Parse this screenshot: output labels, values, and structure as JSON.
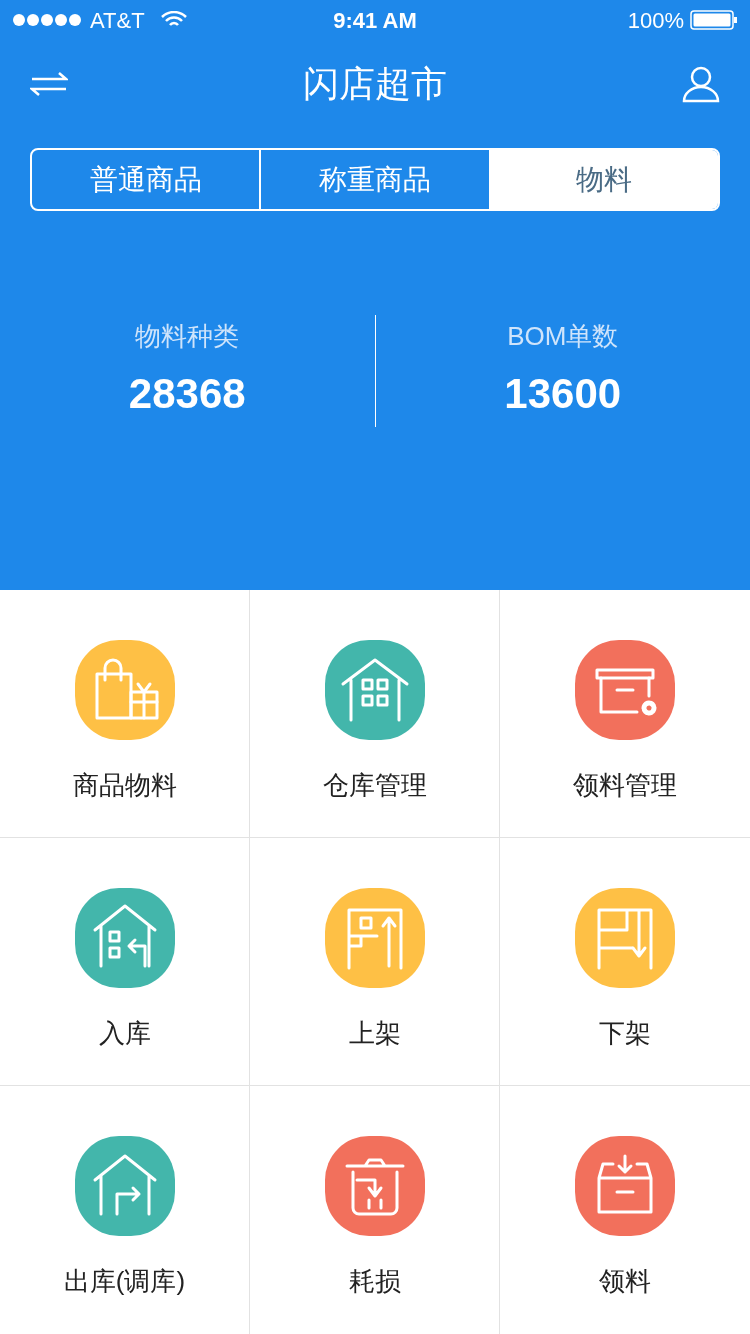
{
  "status_bar": {
    "carrier": "AT&T",
    "time": "9:41 AM",
    "battery": "100%"
  },
  "header": {
    "title": "闪店超市"
  },
  "tabs": [
    {
      "label": "普通商品",
      "selected": false
    },
    {
      "label": "称重商品",
      "selected": false
    },
    {
      "label": "物料",
      "selected": true
    }
  ],
  "stats": [
    {
      "label": "物料种类",
      "value": "28368"
    },
    {
      "label": "BOM单数",
      "value": "13600"
    }
  ],
  "menu": [
    {
      "label": "商品物料",
      "color": "#fec045"
    },
    {
      "label": "仓库管理",
      "color": "#43b6ab"
    },
    {
      "label": "领料管理",
      "color": "#f2705c"
    },
    {
      "label": "入库",
      "color": "#43b6ab"
    },
    {
      "label": "上架",
      "color": "#fec045"
    },
    {
      "label": "下架",
      "color": "#fec045"
    },
    {
      "label": "出库(调库)",
      "color": "#43b6ab"
    },
    {
      "label": "耗损",
      "color": "#f2705c"
    },
    {
      "label": "领料",
      "color": "#f2705c"
    }
  ]
}
